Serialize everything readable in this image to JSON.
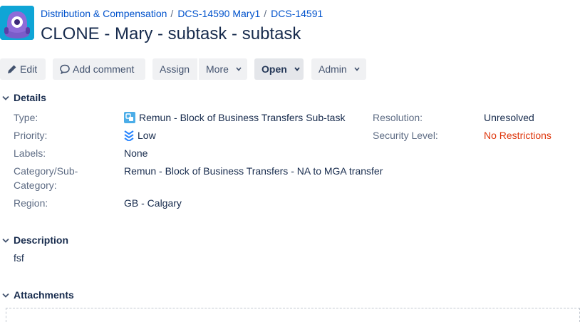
{
  "breadcrumb": {
    "project": "Distribution & Compensation",
    "parent": "DCS-14590 Mary1",
    "issue": "DCS-14591"
  },
  "issue": {
    "title": "CLONE - Mary - subtask - subtask"
  },
  "toolbar": {
    "edit": "Edit",
    "add_comment": "Add comment",
    "assign": "Assign",
    "more": "More",
    "open": "Open",
    "admin": "Admin"
  },
  "details": {
    "header": "Details",
    "type_label": "Type:",
    "type_value": "Remun - Block of Business Transfers Sub-task",
    "priority_label": "Priority:",
    "priority_value": "Low",
    "labels_label": "Labels:",
    "labels_value": "None",
    "category_label_1": "Category/Sub-",
    "category_label_2": "Category:",
    "category_value": "Remun - Block of Business Transfers - NA to MGA transfer",
    "region_label": "Region:",
    "region_value": "GB - Calgary",
    "resolution_label": "Resolution:",
    "resolution_value": "Unresolved",
    "security_label": "Security Level:",
    "security_value": "No Restrictions"
  },
  "description": {
    "header": "Description",
    "text": "fsf"
  },
  "attachments": {
    "header": "Attachments"
  },
  "icons": {
    "avatar": "robot-avatar-icon",
    "edit": "pencil-icon",
    "comment": "comment-bubble-icon",
    "dropdown": "chevron-down-icon",
    "type": "subtask-icon",
    "priority": "priority-low-icon",
    "twisty": "chevron-down-icon"
  },
  "colors": {
    "link": "#0052cc",
    "danger": "#de350b",
    "avatar_bg": "#0fa5d6",
    "priority_low": "#2684ff"
  }
}
